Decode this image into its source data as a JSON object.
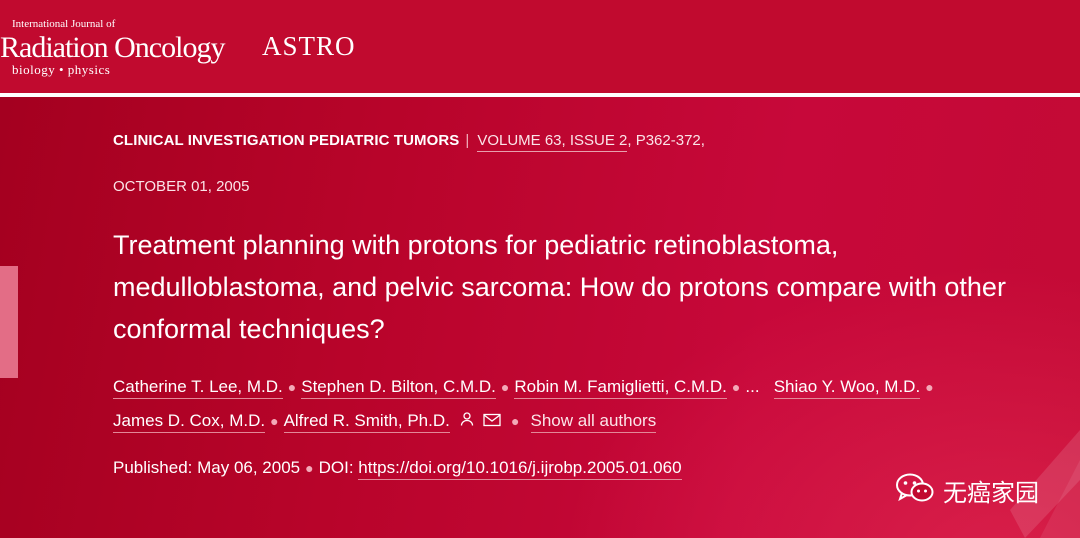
{
  "journal": {
    "small_line": "International Journal of",
    "name": "Radiation Oncology",
    "subtitle": "biology • physics",
    "partner": "ASTRO"
  },
  "article": {
    "section": "CLINICAL INVESTIGATION PEDIATRIC TUMORS",
    "volume_issue": "VOLUME 63, ISSUE 2",
    "pages": ", P362-372,",
    "date": "OCTOBER 01, 2005",
    "title": "Treatment planning with protons for pediatric retinoblastoma, medulloblastoma, and pelvic sarcoma: How do protons compare with other conformal techniques?",
    "authors": [
      "Catherine T. Lee, M.D.",
      "Stephen D. Bilton, C.M.D.",
      "Robin M. Famiglietti, C.M.D.",
      "...",
      "Shiao Y. Woo, M.D.",
      "James D. Cox, M.D.",
      "Alfred R. Smith, Ph.D."
    ],
    "show_all_authors": "Show all authors",
    "published_label": "Published: May 06, 2005",
    "doi_label": "DOI:",
    "doi_url": "https://doi.org/10.1016/j.ijrobp.2005.01.060"
  },
  "icons": {
    "person": "person-icon",
    "mail": "mail-icon",
    "wechat": "wechat-icon"
  },
  "watermark": "无癌家园"
}
